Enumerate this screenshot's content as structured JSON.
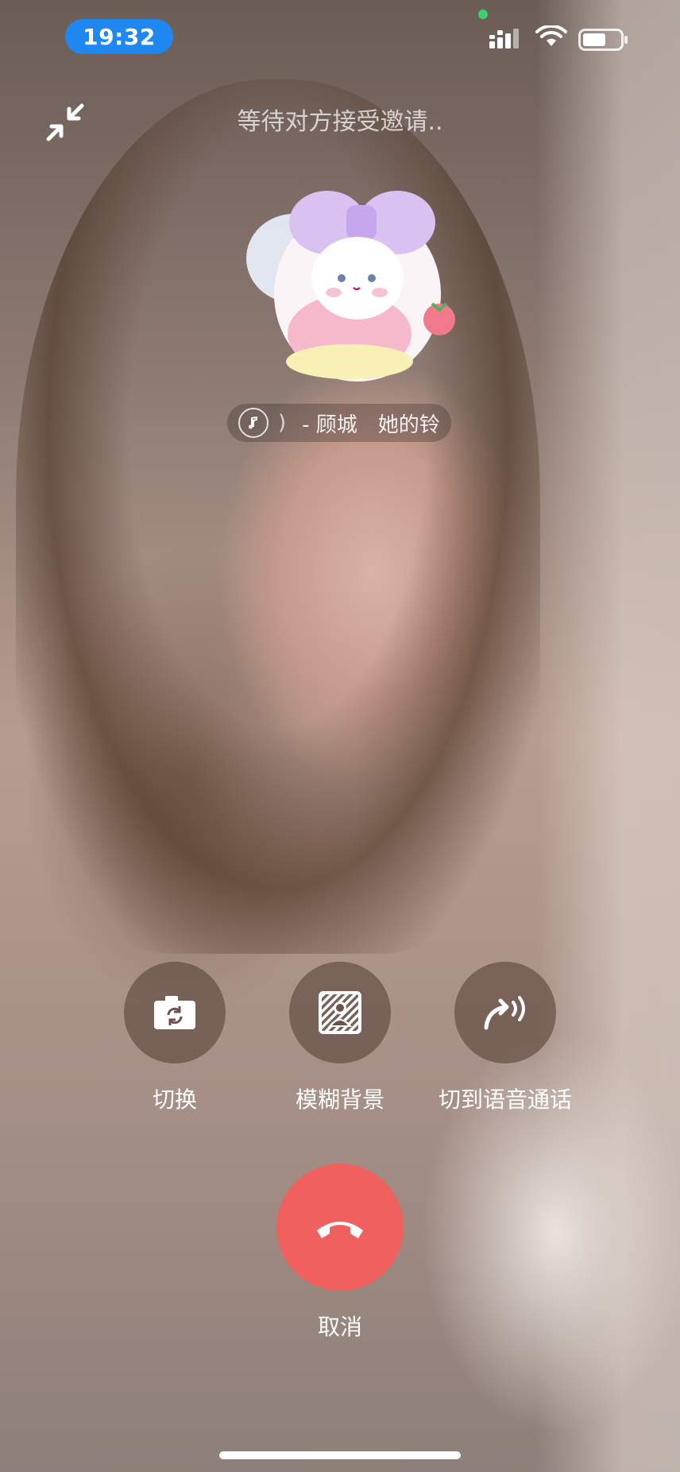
{
  "status_bar": {
    "time": "19:32",
    "accent_color": "#1e88f0",
    "icons": [
      "signal-icon",
      "wifi-icon",
      "battery-icon"
    ],
    "battery_level": 0.55
  },
  "call": {
    "waiting_text": "等待对方接受邀请..",
    "ringtone_text": "- 顾城　她的铃"
  },
  "controls": {
    "switch_camera": {
      "label": "切换",
      "icon": "camera-switch-icon"
    },
    "blur_background": {
      "label": "模糊背景",
      "icon": "blur-background-icon"
    },
    "switch_voice": {
      "label": "切到语音通话",
      "icon": "voice-call-icon"
    }
  },
  "cancel": {
    "label": "取消",
    "color": "#f0605f",
    "icon": "hang-up-icon"
  }
}
